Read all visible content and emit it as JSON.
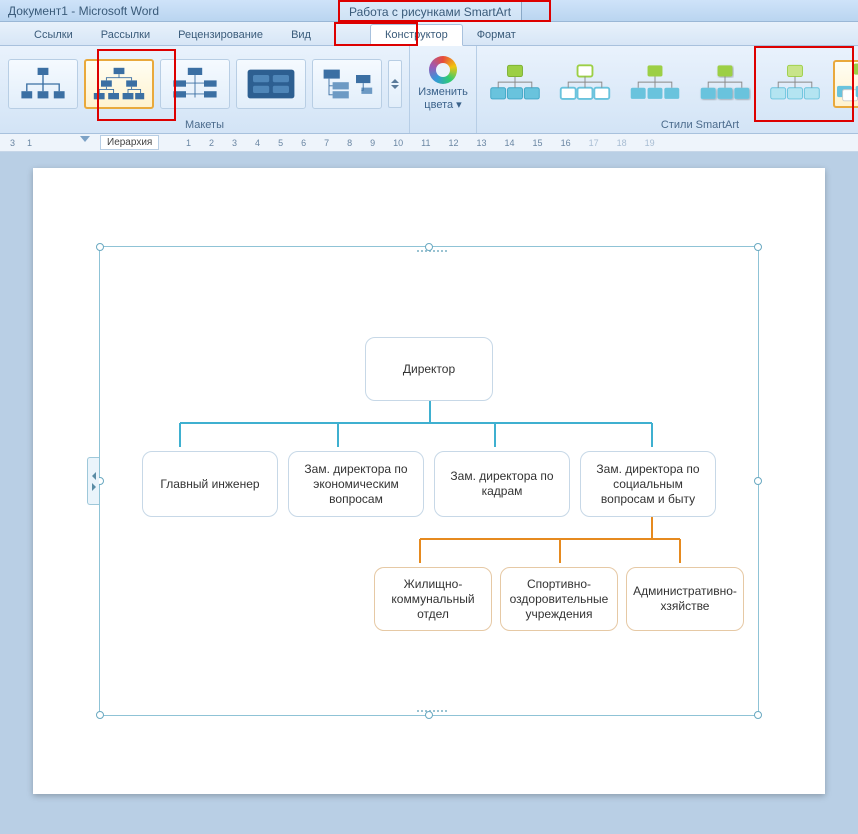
{
  "titlebar": {
    "document": "Документ1 - Microsoft Word",
    "context": "Работа с рисунками SmartArt"
  },
  "tabs": {
    "items": [
      "Ссылки",
      "Рассылки",
      "Рецензирование",
      "Вид",
      "Конструктор",
      "Формат"
    ],
    "active_index": 4
  },
  "ribbon": {
    "layouts_label": "Макеты",
    "change_colors": "Изменить цвета ▾",
    "styles_label": "Стили SmartArt"
  },
  "ruler": {
    "tag": "Иерархия",
    "negatives": [
      "3",
      "1"
    ],
    "positives": [
      "1",
      "2",
      "3",
      "4",
      "5",
      "6",
      "7",
      "8",
      "9",
      "10",
      "11",
      "12",
      "13",
      "14",
      "15",
      "16",
      "17",
      "18",
      "19"
    ],
    "grey_start_index": 16
  },
  "chart_data": {
    "type": "hierarchy",
    "root": {
      "label": "Директор",
      "color": "green"
    },
    "level2": [
      {
        "label": "Главный инженер",
        "color": "cyan"
      },
      {
        "label": "Зам. директора по экономическим вопросам",
        "color": "cyan"
      },
      {
        "label": "Зам. директора по кадрам",
        "color": "cyan"
      },
      {
        "label": "Зам. директора по социальным вопросам и быту",
        "color": "cyan",
        "children_index": 0
      }
    ],
    "level3_parent_index": 3,
    "level3": [
      {
        "label": "Жилищно-коммунальный отдел",
        "color": "orange"
      },
      {
        "label": "Спортивно-оздоровительные учреждения",
        "color": "orange"
      },
      {
        "label": "Административно-хзяйстве",
        "color": "orange"
      }
    ]
  },
  "highlights": {
    "context_tab": true,
    "designer_tab": true,
    "layout_thumb": 1,
    "style_thumb": 5
  }
}
